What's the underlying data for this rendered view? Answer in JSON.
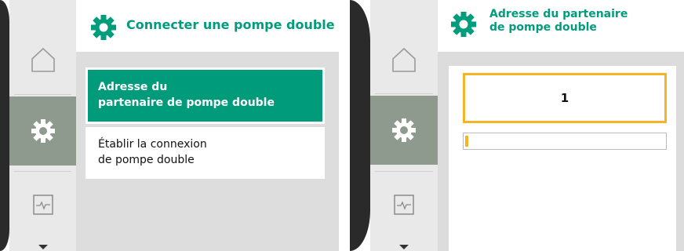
{
  "colors": {
    "accent_green": "#009b7b",
    "highlight_yellow": "#f5b325",
    "rail_selected": "#8f9a8e"
  },
  "left_screen": {
    "rail": {
      "items": [
        {
          "icon": "home-icon",
          "selected": false
        },
        {
          "icon": "gear-icon",
          "selected": true
        },
        {
          "icon": "monitor-icon",
          "selected": false
        }
      ]
    },
    "header": {
      "icon": "gear-icon",
      "title": "Connecter une pompe double"
    },
    "menu": {
      "items": [
        {
          "line1": "Adresse du",
          "line2": "partenaire de pompe double",
          "selected": true
        },
        {
          "line1": "Établir la connexion",
          "line2": "de pompe double",
          "selected": false
        }
      ]
    }
  },
  "right_screen": {
    "rail": {
      "items": [
        {
          "icon": "home-icon",
          "selected": false
        },
        {
          "icon": "gear-icon",
          "selected": true
        },
        {
          "icon": "monitor-icon",
          "selected": false
        }
      ]
    },
    "header": {
      "icon": "gear-icon",
      "title_line1": "Adresse du partenaire",
      "title_line2": "de pompe double"
    },
    "editor": {
      "value": "1",
      "progress_fraction": 0.01
    }
  }
}
